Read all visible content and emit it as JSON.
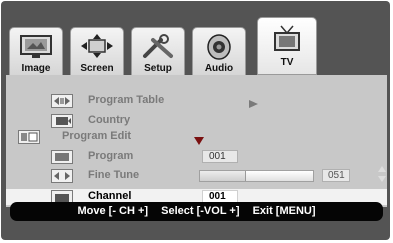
{
  "tabs": [
    {
      "label": "Image",
      "icon": "monitor-icon"
    },
    {
      "label": "Screen",
      "icon": "arrows-icon"
    },
    {
      "label": "Setup",
      "icon": "tools-icon"
    },
    {
      "label": "Audio",
      "icon": "speaker-icon"
    },
    {
      "label": "TV",
      "icon": "tv-icon",
      "active": true
    }
  ],
  "menu": {
    "program_table": "Program Table",
    "country": "Country",
    "program_edit": "Program Edit",
    "program": "Program",
    "program_value": "001",
    "fine_tune": "Fine Tune",
    "fine_tune_value": "051",
    "fine_tune_level": 0.4,
    "channel": "Channel",
    "channel_value": "001"
  },
  "help": {
    "move": "Move [- CH +]",
    "select": "Select [-VOL +]",
    "exit": "Exit [MENU]"
  }
}
